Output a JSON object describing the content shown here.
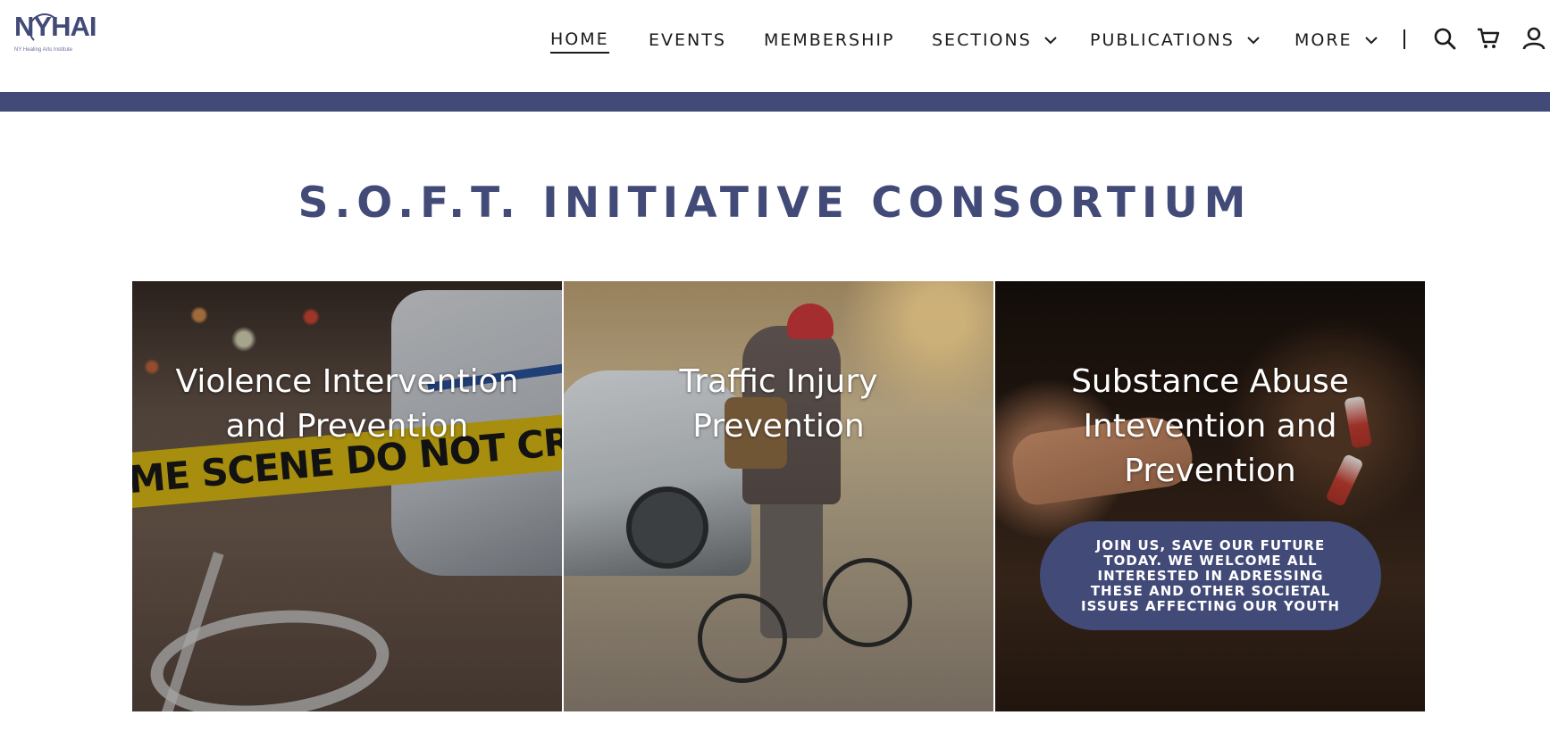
{
  "header": {
    "logo_text": "NYHAI",
    "logo_tagline": "NY Healing Arts Institute",
    "nav": [
      {
        "label": "HOME",
        "active": true
      },
      {
        "label": "EVENTS"
      },
      {
        "label": "MEMBERSHIP"
      },
      {
        "label": "SECTIONS",
        "dropdown": true
      },
      {
        "label": "PUBLICATIONS",
        "dropdown": true
      },
      {
        "label": "MORE",
        "dropdown": true
      }
    ],
    "icons": [
      "search-icon",
      "cart-icon",
      "user-icon"
    ]
  },
  "colors": {
    "accent": "#424a78",
    "text": "#1b1b1b",
    "background": "#ffffff"
  },
  "main": {
    "title": "S.O.F.T. INITIATIVE CONSORTIUM",
    "cards": [
      {
        "title_line1": "Violence Intervention",
        "title_line2": "and Prevention",
        "tape_text": "IME SCENE DO NOT CROSS"
      },
      {
        "title_line1": "Traffic Injury",
        "title_line2": "Prevention"
      },
      {
        "title_line1": "Substance Abuse",
        "title_line2": "Intevention and",
        "title_line3": "Prevention",
        "button_label": "JOIN US, SAVE OUR FUTURE TODAY. WE WELCOME ALL INTERESTED IN ADRESSING THESE AND OTHER SOCIETAL ISSUES AFFECTING OUR YOUTH"
      }
    ]
  }
}
